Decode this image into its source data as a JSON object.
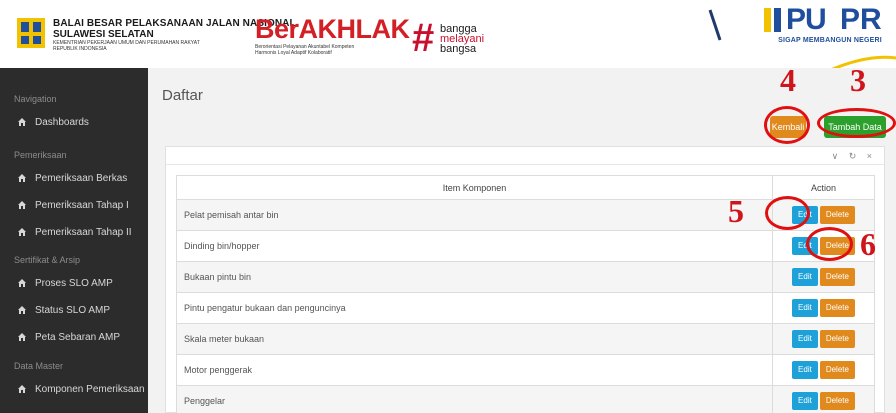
{
  "header": {
    "institution": {
      "line1": "BALAI BESAR PELAKSANAAN JALAN NASIONAL",
      "line2": "SULAWESI SELATAN",
      "line3": "KEMENTRIAN PEKERJAAN UMUM DAN PERUMAHAN RAKYAT",
      "line4": "REPUBLIK INDONESIA"
    },
    "berakhlak": {
      "word": "BerAKHLAK",
      "tag1": "Berorientasi Pelayanan Akuntabel Kompeten",
      "tag2": "Harmonis Loyal Adaptif Kolaboratif"
    },
    "bangga": {
      "w1": "bangga",
      "w2": "melayani",
      "w3": "bangsa"
    },
    "pupr": {
      "left": "PU",
      "right": "PR",
      "tagline": "SIGAP MEMBANGUN NEGERI"
    }
  },
  "sidebar": {
    "sections": [
      {
        "title": "Navigation",
        "items": [
          "Dashboards"
        ]
      },
      {
        "title": "Pemeriksaan",
        "items": [
          "Pemeriksaan Berkas",
          "Pemeriksaan Tahap I",
          "Pemeriksaan Tahap II"
        ]
      },
      {
        "title": "Sertifikat & Arsip",
        "items": [
          "Proses SLO AMP",
          "Status SLO AMP",
          "Peta Sebaran AMP"
        ]
      },
      {
        "title": "Data Master",
        "items": [
          "Komponen Pemeriksaan"
        ]
      }
    ],
    "item_icon": "home-icon"
  },
  "main": {
    "title": "Daftar",
    "buttons": {
      "back": "Kembali",
      "add": "Tambah Data"
    },
    "panel_tools": "∨ ↻ ×",
    "table": {
      "headers": [
        "Item Komponen",
        "Action"
      ],
      "edit_label": "Edit",
      "delete_label": "Delete",
      "rows": [
        "Pelat pemisah antar bin",
        "Dinding bin/hopper",
        "Bukaan pintu bin",
        "Pintu pengatur bukaan dan penguncinya",
        "Skala meter bukaan",
        "Motor penggerak",
        "Penggelar"
      ]
    }
  },
  "annotations": {
    "n3": "3",
    "n4": "4",
    "n5": "5",
    "n6": "6"
  },
  "colors": {
    "annotation": "#d0141b",
    "edit": "#1ea0d8",
    "delete": "#e08a1e",
    "add": "#2ca02c",
    "sidebar": "#2c2c2c"
  }
}
